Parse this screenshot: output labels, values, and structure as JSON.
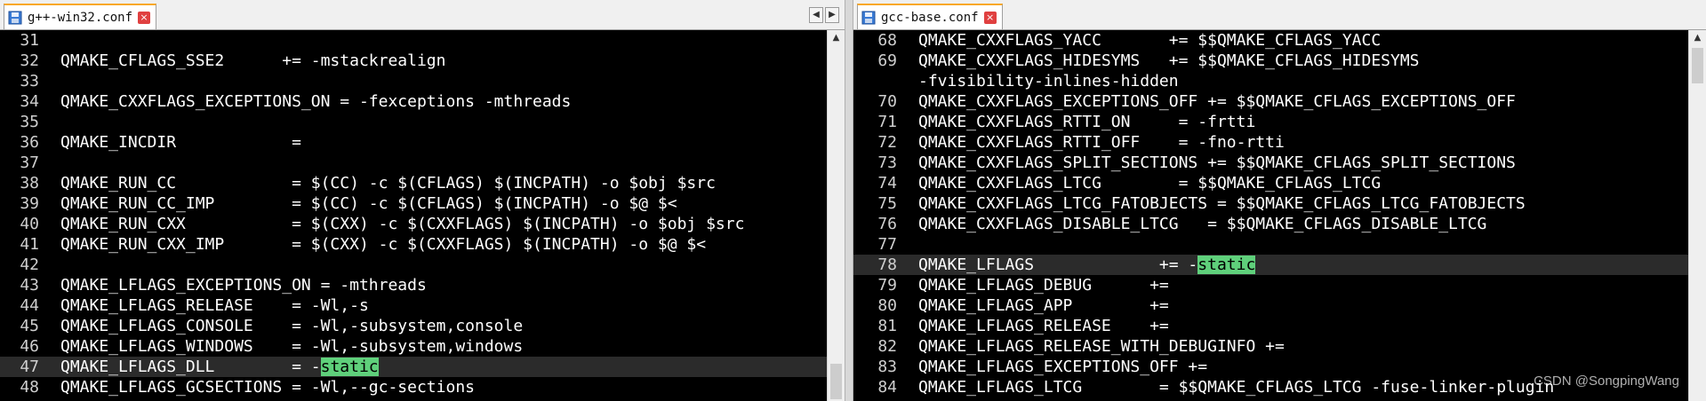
{
  "left_pane": {
    "tab": {
      "label": "g++-win32.conf",
      "icon": "file-icon",
      "close": "×"
    },
    "nav": {
      "prev": "◀",
      "next": "▶"
    },
    "scroll": {
      "up": "▲",
      "down": "▼"
    },
    "current_line_index": 16,
    "lines": [
      {
        "num": "31",
        "text": ""
      },
      {
        "num": "32",
        "text": "QMAKE_CFLAGS_SSE2      += -mstackrealign"
      },
      {
        "num": "33",
        "text": ""
      },
      {
        "num": "34",
        "text": "QMAKE_CXXFLAGS_EXCEPTIONS_ON = -fexceptions -mthreads"
      },
      {
        "num": "35",
        "text": ""
      },
      {
        "num": "36",
        "text": "QMAKE_INCDIR            ="
      },
      {
        "num": "37",
        "text": ""
      },
      {
        "num": "38",
        "text": "QMAKE_RUN_CC            = $(CC) -c $(CFLAGS) $(INCPATH) -o $obj $src"
      },
      {
        "num": "39",
        "text": "QMAKE_RUN_CC_IMP        = $(CC) -c $(CFLAGS) $(INCPATH) -o $@ $<"
      },
      {
        "num": "40",
        "text": "QMAKE_RUN_CXX           = $(CXX) -c $(CXXFLAGS) $(INCPATH) -o $obj $src"
      },
      {
        "num": "41",
        "text": "QMAKE_RUN_CXX_IMP       = $(CXX) -c $(CXXFLAGS) $(INCPATH) -o $@ $<"
      },
      {
        "num": "42",
        "text": ""
      },
      {
        "num": "43",
        "text": "QMAKE_LFLAGS_EXCEPTIONS_ON = -mthreads"
      },
      {
        "num": "44",
        "text": "QMAKE_LFLAGS_RELEASE    = -Wl,-s"
      },
      {
        "num": "45",
        "text": "QMAKE_LFLAGS_CONSOLE    = -Wl,-subsystem,console"
      },
      {
        "num": "46",
        "text": "QMAKE_LFLAGS_WINDOWS    = -Wl,-subsystem,windows"
      },
      {
        "num": "47",
        "text": "QMAKE_LFLAGS_DLL        = -",
        "hl": "static"
      },
      {
        "num": "48",
        "text": "QMAKE_LFLAGS_GCSECTIONS = -Wl,--gc-sections"
      }
    ]
  },
  "right_pane": {
    "tab": {
      "label": "gcc-base.conf",
      "icon": "file-icon",
      "close": "×"
    },
    "scroll": {
      "up": "▲",
      "down": "▼"
    },
    "current_line_index": 11,
    "lines": [
      {
        "num": "68",
        "text": "QMAKE_CXXFLAGS_YACC       += $$QMAKE_CFLAGS_YACC"
      },
      {
        "num": "69",
        "text": "QMAKE_CXXFLAGS_HIDESYMS   += $$QMAKE_CFLAGS_HIDESYMS"
      },
      {
        "num": "",
        "text": "-fvisibility-inlines-hidden"
      },
      {
        "num": "70",
        "text": "QMAKE_CXXFLAGS_EXCEPTIONS_OFF += $$QMAKE_CFLAGS_EXCEPTIONS_OFF"
      },
      {
        "num": "71",
        "text": "QMAKE_CXXFLAGS_RTTI_ON     = -frtti"
      },
      {
        "num": "72",
        "text": "QMAKE_CXXFLAGS_RTTI_OFF    = -fno-rtti"
      },
      {
        "num": "73",
        "text": "QMAKE_CXXFLAGS_SPLIT_SECTIONS += $$QMAKE_CFLAGS_SPLIT_SECTIONS"
      },
      {
        "num": "74",
        "text": "QMAKE_CXXFLAGS_LTCG        = $$QMAKE_CFLAGS_LTCG"
      },
      {
        "num": "75",
        "text": "QMAKE_CXXFLAGS_LTCG_FATOBJECTS = $$QMAKE_CFLAGS_LTCG_FATOBJECTS"
      },
      {
        "num": "76",
        "text": "QMAKE_CXXFLAGS_DISABLE_LTCG   = $$QMAKE_CFLAGS_DISABLE_LTCG"
      },
      {
        "num": "77",
        "text": ""
      },
      {
        "num": "78",
        "text": "QMAKE_LFLAGS             += -",
        "hl": "static"
      },
      {
        "num": "79",
        "text": "QMAKE_LFLAGS_DEBUG      +="
      },
      {
        "num": "80",
        "text": "QMAKE_LFLAGS_APP        +="
      },
      {
        "num": "81",
        "text": "QMAKE_LFLAGS_RELEASE    +="
      },
      {
        "num": "82",
        "text": "QMAKE_LFLAGS_RELEASE_WITH_DEBUGINFO +="
      },
      {
        "num": "83",
        "text": "QMAKE_LFLAGS_EXCEPTIONS_OFF +="
      },
      {
        "num": "84",
        "text": "QMAKE_LFLAGS_LTCG        = $$QMAKE_CFLAGS_LTCG -fuse-linker-plugin"
      }
    ]
  },
  "watermark": "CSDN @SongpingWang"
}
